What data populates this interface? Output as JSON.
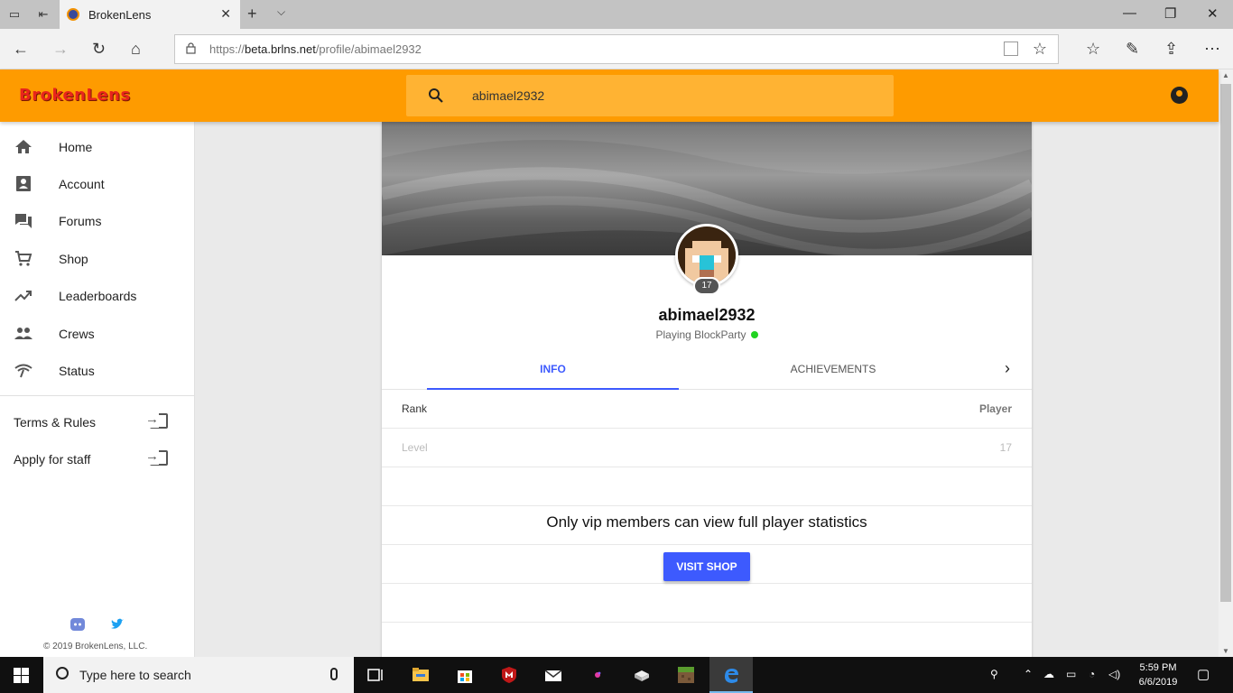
{
  "browser": {
    "tab_title": "BrokenLens",
    "url_prefix": "https://",
    "url_host": "beta.brlns.net",
    "url_path": "/profile/abimael2932"
  },
  "site": {
    "logo": "BrokenLens",
    "search_value": "abimael2932",
    "brand_color": "#fe9b00",
    "accent_color": "#3d5afe"
  },
  "sidebar": {
    "items": [
      {
        "label": "Home",
        "icon": "home-icon"
      },
      {
        "label": "Account",
        "icon": "account-box-icon"
      },
      {
        "label": "Forums",
        "icon": "forum-icon"
      },
      {
        "label": "Shop",
        "icon": "cart-icon"
      },
      {
        "label": "Leaderboards",
        "icon": "trending-up-icon"
      },
      {
        "label": "Crews",
        "icon": "people-icon"
      },
      {
        "label": "Status",
        "icon": "signal-icon"
      }
    ],
    "links": [
      {
        "label": "Terms & Rules"
      },
      {
        "label": "Apply for staff"
      }
    ],
    "copyright": "© 2019 BrokenLens, LLC."
  },
  "profile": {
    "username": "abimael2932",
    "level_badge": "17",
    "status": "Playing BlockParty",
    "tabs": [
      "INFO",
      "ACHIEVEMENTS"
    ],
    "rows": [
      {
        "key": "Rank",
        "value": "Player"
      },
      {
        "key": "Level",
        "value": "17"
      }
    ],
    "vip_message": "Only vip members can view full player statistics",
    "vip_button": "VISIT SHOP"
  },
  "taskbar": {
    "search_placeholder": "Type here to search",
    "time": "5:59 PM",
    "date": "6/6/2019"
  }
}
